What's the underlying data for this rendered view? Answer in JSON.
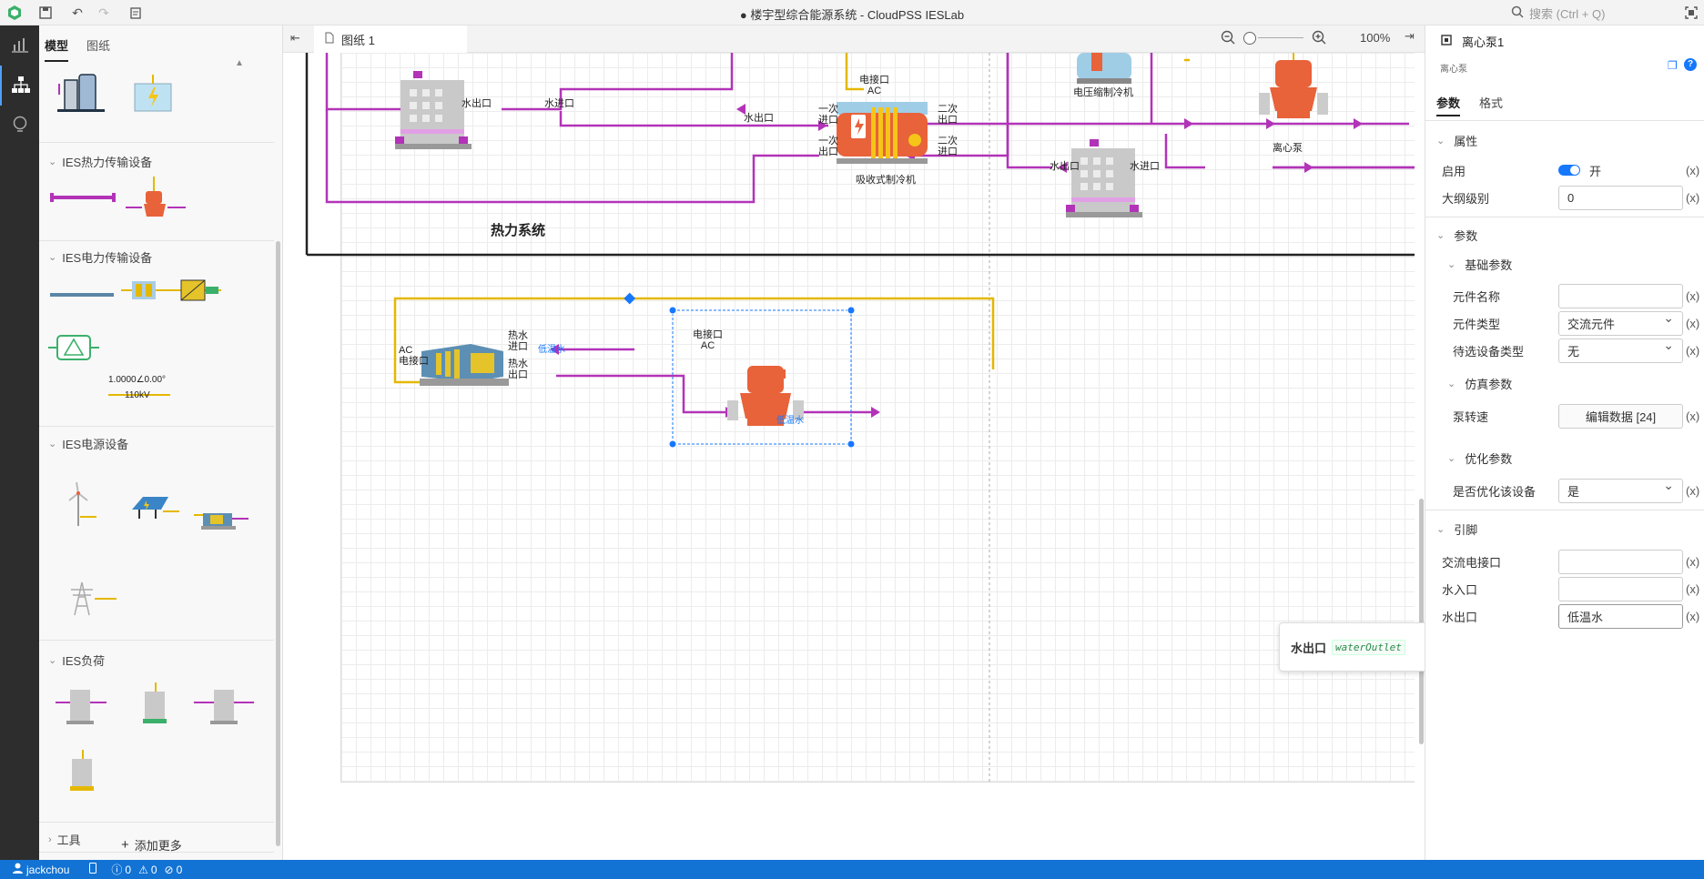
{
  "titlebar": {
    "title": "● 楼宇型综合能源系统 - CloudPSS IESLab",
    "search_placeholder": "搜索 (Ctrl + Q)"
  },
  "sidebar": {
    "tabs": [
      "模型",
      "图纸"
    ],
    "sections": [
      {
        "label": "IES热力传输设备"
      },
      {
        "label": "IES电力传输设备"
      },
      {
        "label": "IES电源设备"
      },
      {
        "label": "IES负荷"
      },
      {
        "label": "工具"
      }
    ],
    "transformer_label": "1.0000∠0.00°",
    "transformer_voltage": "110kV",
    "add_more": "添加更多"
  },
  "editor": {
    "tab": "图纸 1",
    "zoom": "100%",
    "canvas_labels": {
      "thermal_system": "热力系统",
      "water_out": "水出口",
      "water_in": "水进口",
      "elec_port": "电接口",
      "ac": "AC",
      "primary_in": "一次\n进口",
      "primary_out": "一次\n出口",
      "secondary_out": "二次\n出口",
      "secondary_in": "二次\n进口",
      "absorption_chiller": "吸收式制冷机",
      "compression_chiller": "电压缩制冷机",
      "centrifugal_pump": "离心泵",
      "hot_water_in": "热水\n进口",
      "hot_water_out": "热水\n出口",
      "low_temp_water": "低温水",
      "ac_elec_port": "AC\n电接口"
    }
  },
  "props": {
    "title": "离心泵1",
    "subtitle": "离心泵",
    "tabs": [
      "参数",
      "格式"
    ],
    "sections": {
      "attributes": "属性",
      "params": "参数",
      "basic": "基础参数",
      "sim": "仿真参数",
      "opt": "优化参数",
      "pins": "引脚"
    },
    "fields": {
      "enabled_label": "启用",
      "enabled_value": "开",
      "outline_label": "大纲级别",
      "outline_value": "0",
      "name_label": "元件名称",
      "name_value": "",
      "type_label": "元件类型",
      "type_value": "交流元件",
      "candidate_label": "待选设备类型",
      "candidate_value": "无",
      "speed_label": "泵转速",
      "speed_value": "编辑数据 [24]",
      "optimize_label": "是否优化该设备",
      "optimize_value": "是",
      "ac_port_label": "交流电接口",
      "ac_port_value": "",
      "water_in_label": "水入口",
      "water_in_value": "",
      "water_out_label": "水出口",
      "water_out_value": "低温水",
      "x": "(x)"
    }
  },
  "tooltip": {
    "label": "水出口",
    "code": "waterOutlet"
  },
  "status": {
    "user": "jackchou",
    "errors": "0",
    "warnings": "0",
    "infos": "0"
  },
  "colors": {
    "purple": "#b233b8",
    "yellow": "#e5b800",
    "accent": "#1677ff",
    "status_bar": "#1273d4"
  }
}
